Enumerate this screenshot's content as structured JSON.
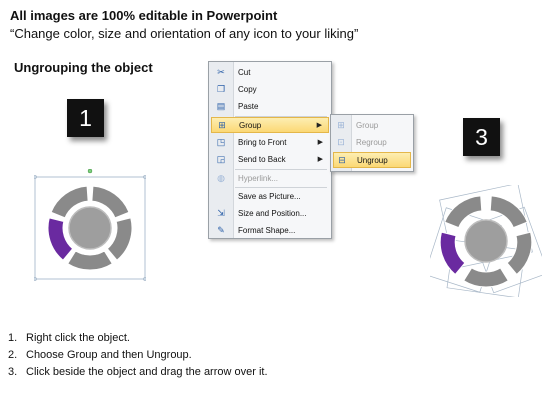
{
  "header": {
    "headline": "All images are 100% editable in Powerpoint",
    "subline": "“Change color, size and orientation of any icon to your liking”",
    "section_title": "Ungrouping the object"
  },
  "boxes": {
    "left": "1",
    "right": "3"
  },
  "context_menu": {
    "items": [
      {
        "label": "Cut",
        "icon": "scissors-icon"
      },
      {
        "label": "Copy",
        "icon": "copy-icon"
      },
      {
        "label": "Paste",
        "icon": "paste-icon"
      },
      {
        "label": "Group",
        "icon": "group-icon",
        "submenu": true,
        "highlighted": true
      },
      {
        "label": "Bring to Front",
        "icon": "bring-front-icon",
        "submenu": true
      },
      {
        "label": "Send to Back",
        "icon": "send-back-icon",
        "submenu": true
      },
      {
        "label": "Hyperlink...",
        "icon": "globe-icon",
        "disabled": true
      },
      {
        "label": "Save as Picture...",
        "icon": "none"
      },
      {
        "label": "Size and Position...",
        "icon": "size-icon"
      },
      {
        "label": "Format Shape...",
        "icon": "format-icon"
      }
    ]
  },
  "submenu": {
    "items": [
      {
        "label": "Group",
        "icon": "group-icon",
        "disabled": true
      },
      {
        "label": "Regroup",
        "icon": "regroup-icon",
        "disabled": true
      },
      {
        "label": "Ungroup",
        "icon": "ungroup-icon",
        "highlighted": true
      }
    ]
  },
  "steps": [
    {
      "n": "1.",
      "text": "Right click the object."
    },
    {
      "n": "2.",
      "text": "Choose Group and then Ungroup."
    },
    {
      "n": "3.",
      "text": "Click beside the object and drag the arrow over it."
    }
  ],
  "colors": {
    "segment_gray": "#8a8a8a",
    "segment_purple": "#6a2aa0",
    "center_gray": "#9e9e9e",
    "menu_highlight": "#fbd875"
  }
}
